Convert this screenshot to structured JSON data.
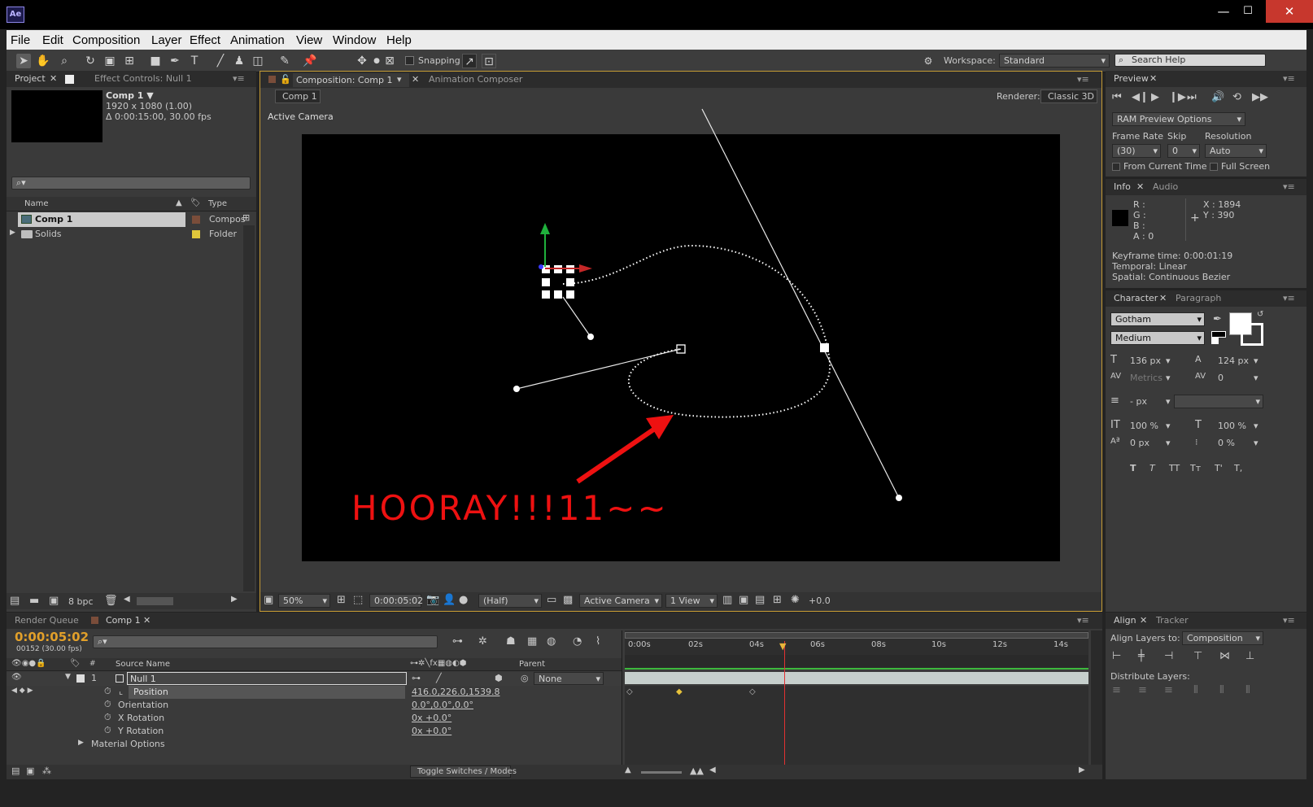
{
  "app": {
    "logo": "Ae"
  },
  "window_controls": {
    "minimize": "—",
    "maximize": "☐",
    "close": "✕"
  },
  "menu": [
    "File",
    "Edit",
    "Composition",
    "Layer",
    "Effect",
    "Animation",
    "View",
    "Window",
    "Help"
  ],
  "toolbar": {
    "snapping": "Snapping",
    "workspace_label": "Workspace:",
    "workspace_value": "Standard",
    "search_placeholder": "Search Help"
  },
  "project": {
    "tab": "Project",
    "effect_controls": "Effect Controls: Null 1",
    "comp_name": "Comp 1 ▼",
    "comp_res": "1920 x 1080 (1.00)",
    "comp_dur": "Δ 0:00:15:00, 30.00 fps",
    "col_name": "Name",
    "col_type": "Type",
    "items": [
      {
        "name": "Comp 1",
        "type": "Compos",
        "label_color": "#7a4d3a"
      },
      {
        "name": "Solids",
        "type": "Folder",
        "label_color": "#e0c73b"
      }
    ],
    "bpc": "8 bpc"
  },
  "composition": {
    "tab": "Composition: Comp 1",
    "tab2": "Animation Composer",
    "breadcrumb": "Comp 1",
    "renderer_label": "Renderer:",
    "renderer_value": "Classic 3D",
    "camera_label": "Active Camera",
    "annotation": "HOORAY!!!11~~",
    "zoom": "50%",
    "timecode": "0:00:05:02",
    "resolution": "(Half)",
    "view_camera": "Active Camera",
    "views": "1 View",
    "exposure": "+0.0"
  },
  "preview": {
    "tab": "Preview",
    "ram_options": "RAM Preview Options",
    "frame_rate_label": "Frame Rate",
    "skip_label": "Skip",
    "resolution_label": "Resolution",
    "frame_rate": "(30)",
    "skip": "0",
    "resolution": "Auto",
    "from_current": "From Current Time",
    "full_screen": "Full Screen"
  },
  "info": {
    "tab": "Info",
    "tab2": "Audio",
    "r": "R :",
    "g": "G :",
    "b": "B :",
    "a": "A : 0",
    "x": "X : 1894",
    "y": "Y : 390",
    "keyframe_time": "Keyframe time: 0:00:01:19",
    "temporal": "Temporal: Linear",
    "spatial": "Spatial: Continuous Bezier"
  },
  "character": {
    "tab": "Character",
    "tab2": "Paragraph",
    "font": "Gotham",
    "style": "Medium",
    "size": "136 px",
    "leading": "124 px",
    "kerning": "Metrics",
    "tracking": "0",
    "stroke": "- px",
    "vscale": "100 %",
    "hscale": "100 %",
    "baseline": "0 px",
    "tsume": "0 %",
    "styles": [
      "T",
      "T",
      "TT",
      "Tт",
      "T'",
      "T,"
    ]
  },
  "align": {
    "tab": "Align",
    "tab2": "Tracker",
    "align_to_label": "Align Layers to:",
    "align_to": "Composition",
    "distribute": "Distribute Layers:"
  },
  "timeline": {
    "tab_rq": "Render Queue",
    "tab_comp": "Comp 1",
    "timecode": "0:00:05:02",
    "frames": "00152 (30.00 fps)",
    "col_source": "Source Name",
    "col_parent": "Parent",
    "layer_num": "1",
    "layer_name": "Null 1",
    "parent": "None",
    "props": [
      {
        "name": "Position",
        "value": "416.0,226.0,1539.8"
      },
      {
        "name": "Orientation",
        "value": "0.0°,0.0°,0.0°"
      },
      {
        "name": "X Rotation",
        "value": "0x +0.0°"
      },
      {
        "name": "Y Rotation",
        "value": "0x +0.0°"
      }
    ],
    "material": "Material Options",
    "ruler": [
      "0:00s",
      "02s",
      "04s",
      "06s",
      "08s",
      "10s",
      "12s",
      "14s"
    ],
    "toggle": "Toggle Switches / Modes"
  }
}
